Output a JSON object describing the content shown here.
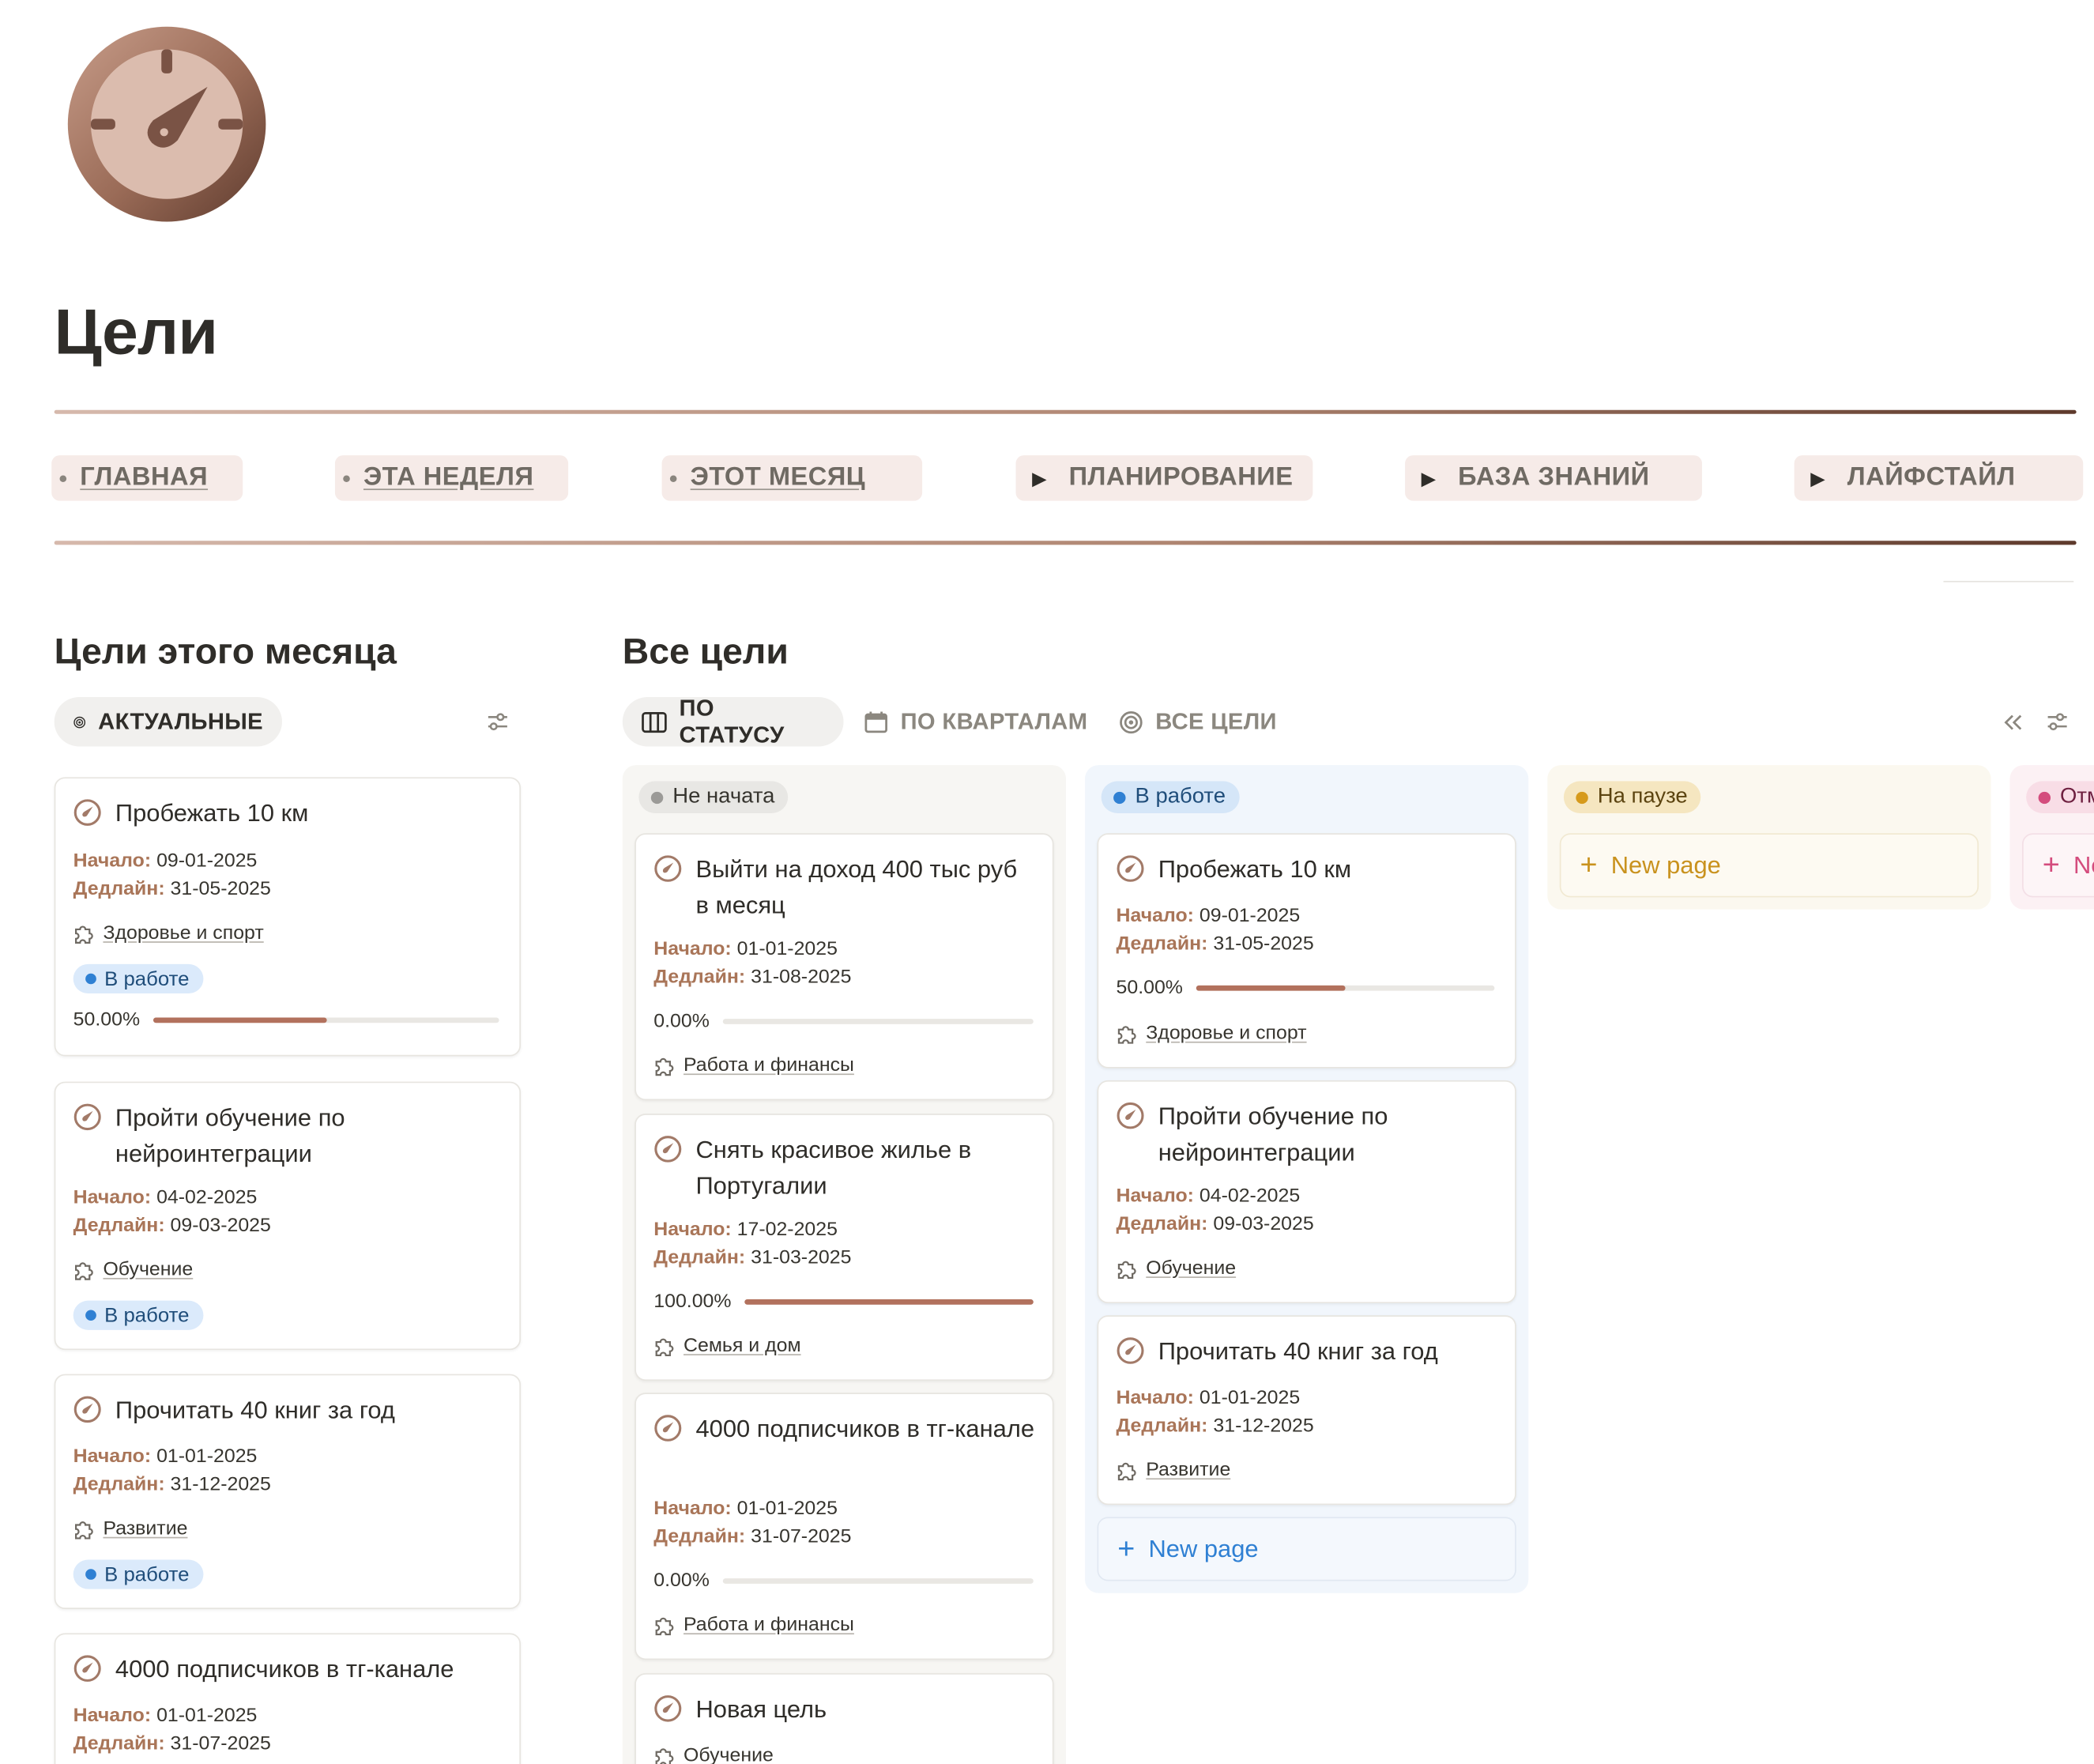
{
  "page": {
    "title": "Цели",
    "icon": "stopwatch-icon"
  },
  "nav": [
    {
      "label": "ГЛАВНАЯ",
      "kind": "link"
    },
    {
      "label": "ЭТА НЕДЕЛЯ",
      "kind": "link"
    },
    {
      "label": "ЭТОТ МЕСЯЦ",
      "kind": "link"
    },
    {
      "label": "ПЛАНИРОВАНИЕ",
      "kind": "toggle"
    },
    {
      "label": "БАЗА ЗНАНИЙ",
      "kind": "toggle"
    },
    {
      "label": "ЛАЙФСТАЙЛ",
      "kind": "toggle"
    }
  ],
  "month": {
    "title": "Цели этого месяца",
    "view": {
      "label": "АКТУАЛЬНЫЕ",
      "icon": "target-icon"
    },
    "cards": [
      {
        "title": "Пробежать 10 км",
        "start_label": "Начало:",
        "start": "09-01-2025",
        "deadline_label": "Дедлайн:",
        "deadline": "31-05-2025",
        "area": "Здоровье и спорт",
        "status": "В работе",
        "progress_text": "50.00%",
        "progress": 0.5
      },
      {
        "title": "Пройти обучение по нейроинтеграции",
        "start_label": "Начало:",
        "start": "04-02-2025",
        "deadline_label": "Дедлайн:",
        "deadline": "09-03-2025",
        "area": "Обучение",
        "status": "В работе"
      },
      {
        "title": "Прочитать 40 книг за год",
        "start_label": "Начало:",
        "start": "01-01-2025",
        "deadline_label": "Дедлайн:",
        "deadline": "31-12-2025",
        "area": "Развитие",
        "status": "В работе"
      },
      {
        "title": "4000 подписчиков в тг-канале",
        "start_label": "Начало:",
        "start": "01-01-2025",
        "deadline_label": "Дедлайн:",
        "deadline": "31-07-2025"
      }
    ]
  },
  "all": {
    "title": "Все цели",
    "tabs": [
      {
        "label": "ПО СТАТУСУ",
        "icon": "board-icon",
        "active": true
      },
      {
        "label": "ПО КВАРТАЛАМ",
        "icon": "calendar-icon",
        "active": false
      },
      {
        "label": "ВСЕ ЦЕЛИ",
        "icon": "target-icon",
        "active": false
      }
    ],
    "columns": [
      {
        "status": "Не начата",
        "dot": "#9b9a97",
        "bg": "#f7f6f3",
        "pill_bg": "#e8e7e4",
        "pill_color": "#37352f",
        "cards": [
          {
            "title": "Выйти на доход 400 тыс руб в месяц",
            "start_label": "Начало:",
            "start": "01-01-2025",
            "deadline_label": "Дедлайн:",
            "deadline": "31-08-2025",
            "progress_text": "0.00%",
            "progress": 0,
            "area": "Работа и финансы"
          },
          {
            "title": "Снять красивое жилье в Португалии",
            "start_label": "Начало:",
            "start": "17-02-2025",
            "deadline_label": "Дедлайн:",
            "deadline": "31-03-2025",
            "progress_text": "100.00%",
            "progress": 1,
            "area": "Семья и дом"
          },
          {
            "title": "4000 подписчиков в тг-канале",
            "start_label": "Начало:",
            "start": "01-01-2025",
            "deadline_label": "Дедлайн:",
            "deadline": "31-07-2025",
            "progress_text": "0.00%",
            "progress": 0,
            "area": "Работа и финансы"
          },
          {
            "title": "Новая цель",
            "area": "Обучение"
          }
        ]
      },
      {
        "status": "В работе",
        "dot": "#2f80d3",
        "bg": "#f1f6fc",
        "pill_bg": "#d5e6f8",
        "pill_color": "#1f4d7a",
        "new_page": "New page",
        "cards": [
          {
            "title": "Пробежать 10 км",
            "start_label": "Начало:",
            "start": "09-01-2025",
            "deadline_label": "Дедлайн:",
            "deadline": "31-05-2025",
            "progress_text": "50.00%",
            "progress": 0.5,
            "area": "Здоровье и спорт"
          },
          {
            "title": "Пройти обучение по нейроинтеграции",
            "start_label": "Начало:",
            "start": "04-02-2025",
            "deadline_label": "Дедлайн:",
            "deadline": "09-03-2025",
            "area": "Обучение"
          },
          {
            "title": "Прочитать 40 книг за год",
            "start_label": "Начало:",
            "start": "01-01-2025",
            "deadline_label": "Дедлайн:",
            "deadline": "31-12-2025",
            "area": "Развитие"
          }
        ]
      },
      {
        "status": "На паузе",
        "dot": "#d69a1c",
        "bg": "#fbf8ef",
        "pill_bg": "#f5e6c0",
        "pill_color": "#5c4410",
        "new_page": "New page",
        "cards": []
      },
      {
        "status": "Отменена",
        "dot": "#d44c7d",
        "bg": "#fcf1f4",
        "pill_bg": "#f8dde6",
        "pill_color": "#6e2040",
        "new_page": "New page",
        "cards": []
      }
    ]
  },
  "colors": {
    "accent_label": "#a97558",
    "progress_fill": "#b2715d",
    "status_blue": "#2f80d3"
  }
}
